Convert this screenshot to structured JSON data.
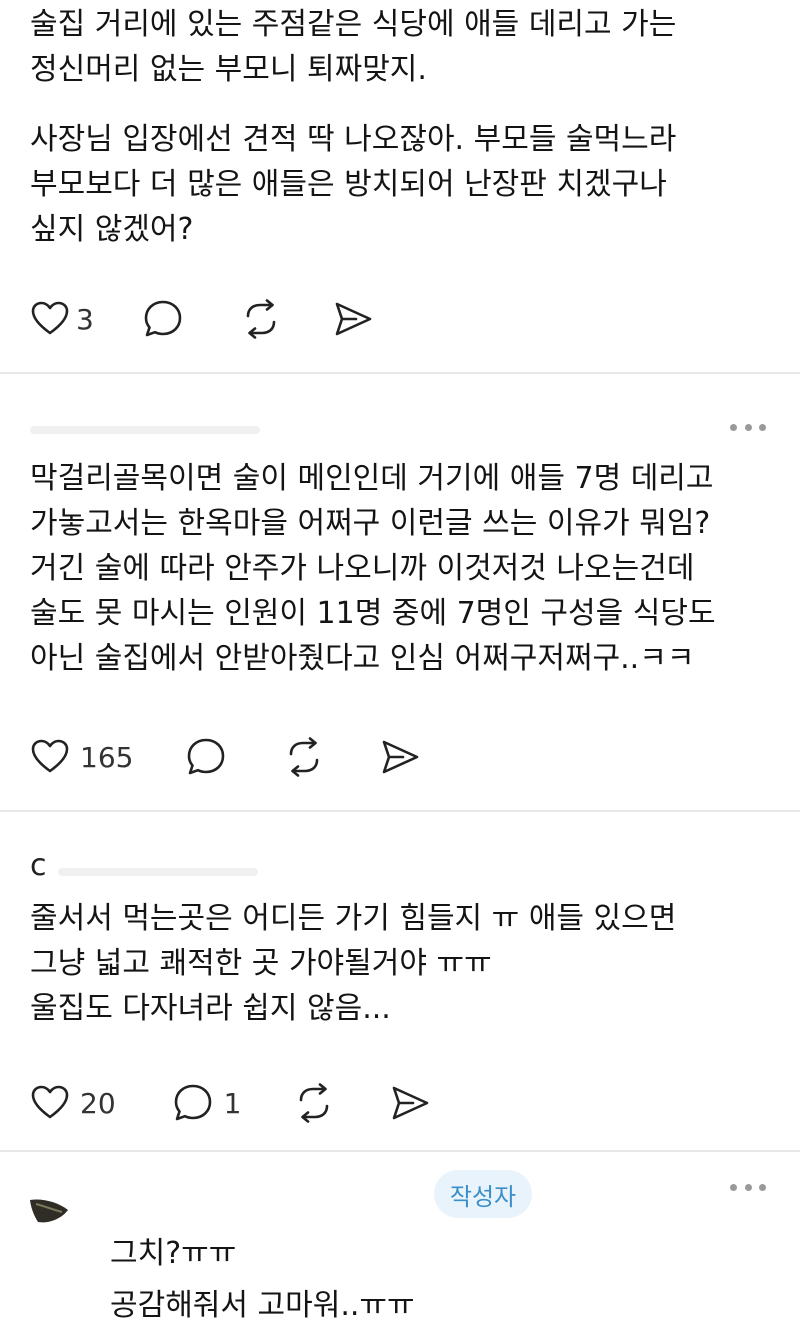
{
  "post1": {
    "para1": "술집 거리에 있는 주점같은 식당에 애들 데리고 가는\n정신머리 없는 부모니 퇴짜맞지.",
    "para2": "사장님 입장에선 견적 딱 나오잖아. 부모들 술먹느라\n부모보다 더 많은 애들은 방치되어 난장판 치겠구나\n싶지 않겠어?",
    "likes": "3"
  },
  "comment1": {
    "text": "막걸리골목이면 술이 메인인데 거기에 애들 7명 데리고\n가놓고서는 한옥마을 어쩌구 이런글 쓰는 이유가 뭐임?\n거긴 술에 따라 안주가 나오니까 이것저것 나오는건데\n술도 못 마시는 인원이 11명 중에 7명인 구성을 식당도\n아닌 술집에서 안받아줬다고 인심 어쩌구저쩌구..ㅋㅋ",
    "likes": "165"
  },
  "comment2": {
    "name_initial": "c",
    "text": "줄서서 먹는곳은 어디든 가기 힘들지 ㅠ  애들 있으면\n그냥 넓고 쾌적한 곳 가야될거야 ㅠㅠ\n 울집도 다자녀라 쉽지 않음...",
    "likes": "20",
    "replies": "1"
  },
  "reply1": {
    "badge": "작성자",
    "line1": "그치?ㅠㅠ",
    "line2": "공감해줘서 고마워..ㅠㅠ"
  },
  "icons": {
    "like": "heart-icon",
    "comment": "speech-bubble-icon",
    "repost": "repost-icon",
    "share": "send-icon",
    "more": "more-dots-icon"
  },
  "colors": {
    "text": "#141414",
    "icon": "#222222",
    "badge_bg": "#e8f3fb",
    "badge_text": "#3a8fc9",
    "divider": "#e8e8e8"
  }
}
